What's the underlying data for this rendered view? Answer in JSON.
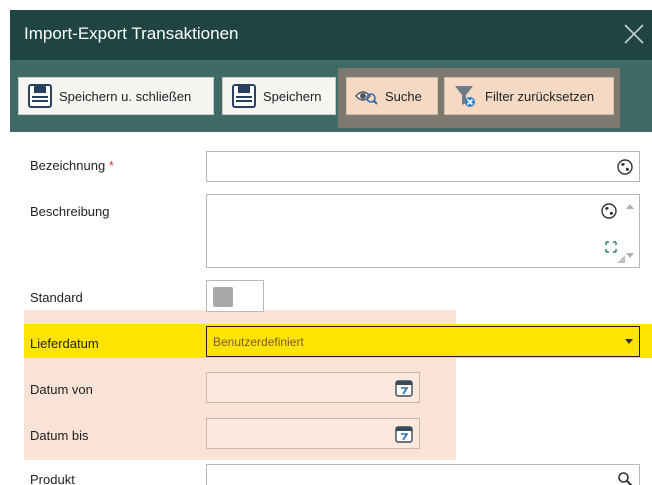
{
  "window": {
    "title": "Import-Export Transaktionen"
  },
  "toolbar": {
    "save_close_label": "Speichern u. schließen",
    "save_label": "Speichern",
    "search_label": "Suche",
    "reset_filter_label": "Filter zurücksetzen"
  },
  "form": {
    "bezeichnung": {
      "label": "Bezeichnung",
      "required_mark": "*",
      "value": ""
    },
    "beschreibung": {
      "label": "Beschreibung",
      "value": ""
    },
    "standard": {
      "label": "Standard",
      "checked": false
    },
    "lieferdatum": {
      "label": "Lieferdatum",
      "value": "Benutzerdefiniert"
    },
    "datum_von": {
      "label": "Datum von",
      "value": ""
    },
    "datum_bis": {
      "label": "Datum bis",
      "value": ""
    },
    "produkt": {
      "label": "Produkt",
      "value": ""
    }
  },
  "colors": {
    "titlebar": "#1f4442",
    "toolbar": "#3f6a66",
    "highlight_yellow": "#ffe400",
    "highlight_peach": "#f8e3d6",
    "required": "#e03a3a"
  },
  "icons": [
    "close-icon",
    "save-icon",
    "eye-search-icon",
    "filter-reset-icon",
    "globe-icon",
    "expand-icon",
    "calendar-icon",
    "search-icon"
  ]
}
